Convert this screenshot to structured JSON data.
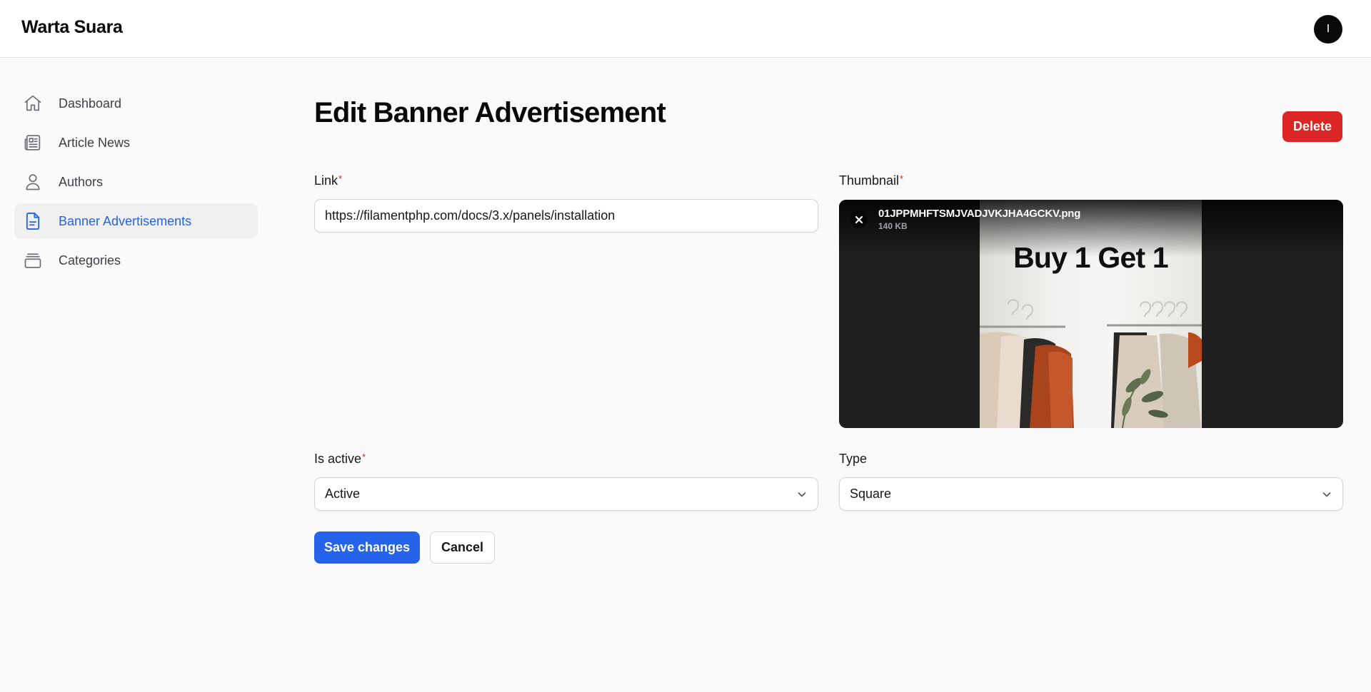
{
  "app": {
    "brand": "Warta Suara",
    "avatar_initial": "I"
  },
  "sidebar": {
    "items": [
      {
        "label": "Dashboard",
        "icon": "home-icon",
        "active": false
      },
      {
        "label": "Article News",
        "icon": "newspaper-icon",
        "active": false
      },
      {
        "label": "Authors",
        "icon": "user-icon",
        "active": false
      },
      {
        "label": "Banner Advertisements",
        "icon": "document-text-icon",
        "active": true
      },
      {
        "label": "Categories",
        "icon": "stack-icon",
        "active": false
      }
    ]
  },
  "page": {
    "title": "Edit Banner Advertisement",
    "delete_label": "Delete"
  },
  "form": {
    "link": {
      "label": "Link",
      "required_mark": "*",
      "value": "https://filamentphp.com/docs/3.x/panels/installation"
    },
    "thumbnail": {
      "label": "Thumbnail",
      "required_mark": "*",
      "file_name": "01JPPMHFTSMJVADJVKJHA4GCKV.png",
      "file_size": "140 KB",
      "banner_text": "Buy 1 Get 1"
    },
    "is_active": {
      "label": "Is active",
      "required_mark": "*",
      "value": "Active"
    },
    "type": {
      "label": "Type",
      "value": "Square"
    }
  },
  "actions": {
    "save_label": "Save changes",
    "cancel_label": "Cancel"
  },
  "colors": {
    "primary": "#2563eb",
    "danger": "#dc2626",
    "required": "#dc2626",
    "brand_text": "#09090b"
  }
}
